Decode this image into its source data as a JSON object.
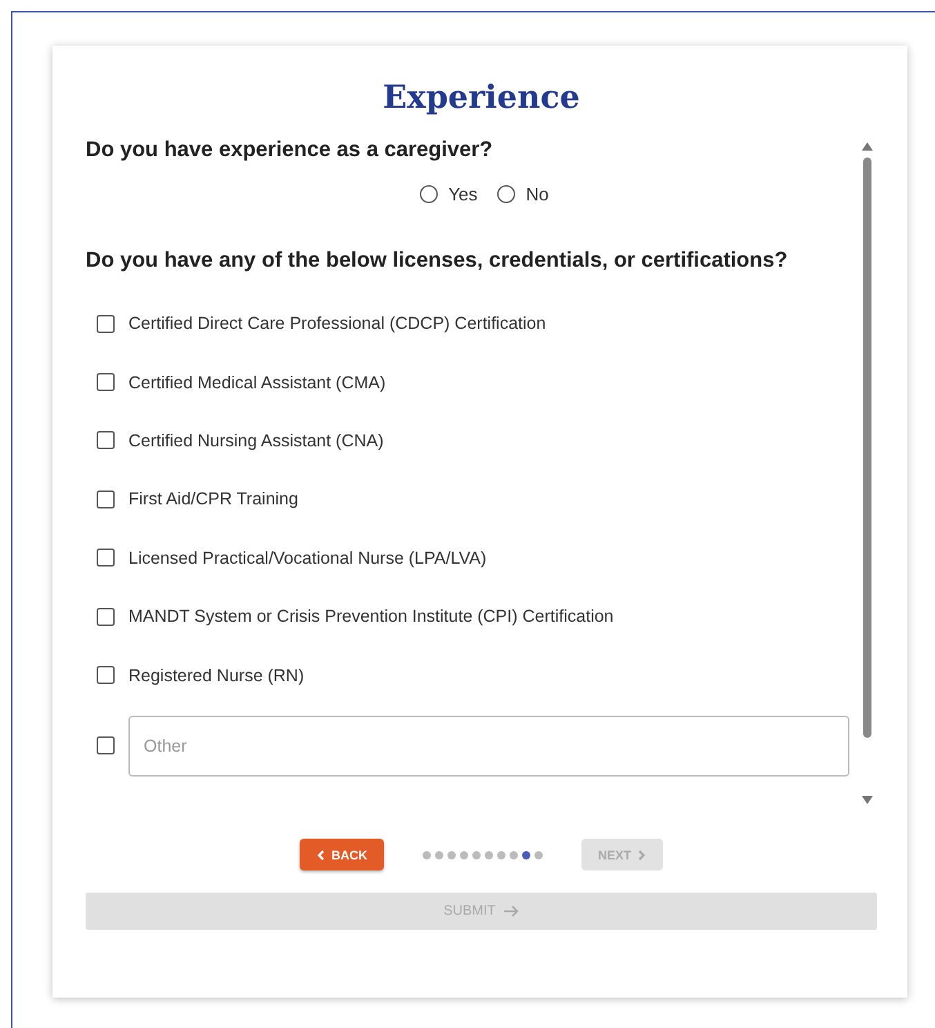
{
  "title": "Experience",
  "caregiver_question": {
    "label": "Do you have experience as a caregiver?",
    "options": [
      {
        "label": "Yes",
        "selected": false
      },
      {
        "label": "No",
        "selected": false
      }
    ]
  },
  "credentials_question": {
    "label": "Do you have any of the below licenses, credentials, or certifications?",
    "options": [
      {
        "kind": "checkbox",
        "label": "Certified Direct Care Professional (CDCP) Certification",
        "checked": false
      },
      {
        "kind": "checkbox",
        "label": "Certified Medical Assistant (CMA)",
        "checked": false
      },
      {
        "kind": "checkbox",
        "label": "Certified Nursing Assistant (CNA)",
        "checked": false
      },
      {
        "kind": "checkbox",
        "label": "First Aid/CPR Training",
        "checked": false
      },
      {
        "kind": "checkbox",
        "label": "Licensed Practical/Vocational Nurse (LPA/LVA)",
        "checked": false
      },
      {
        "kind": "checkbox",
        "label": "MANDT System or Crisis Prevention Institute (CPI) Certification",
        "checked": false
      },
      {
        "kind": "checkbox",
        "label": "Registered Nurse (RN)",
        "checked": false
      },
      {
        "kind": "other",
        "placeholder": "Other",
        "checked": false
      }
    ]
  },
  "back_button": {
    "label": "BACK",
    "disabled": false
  },
  "pager": [
    {
      "selected": false
    },
    {
      "selected": false
    },
    {
      "selected": false
    },
    {
      "selected": false
    },
    {
      "selected": false
    },
    {
      "selected": false
    },
    {
      "selected": false
    },
    {
      "selected": false
    },
    {
      "selected": true
    },
    {
      "selected": false
    }
  ],
  "next_button": {
    "label": "NEXT",
    "disabled": true
  },
  "submit_button": {
    "label": "SUBMIT",
    "disabled": true
  }
}
